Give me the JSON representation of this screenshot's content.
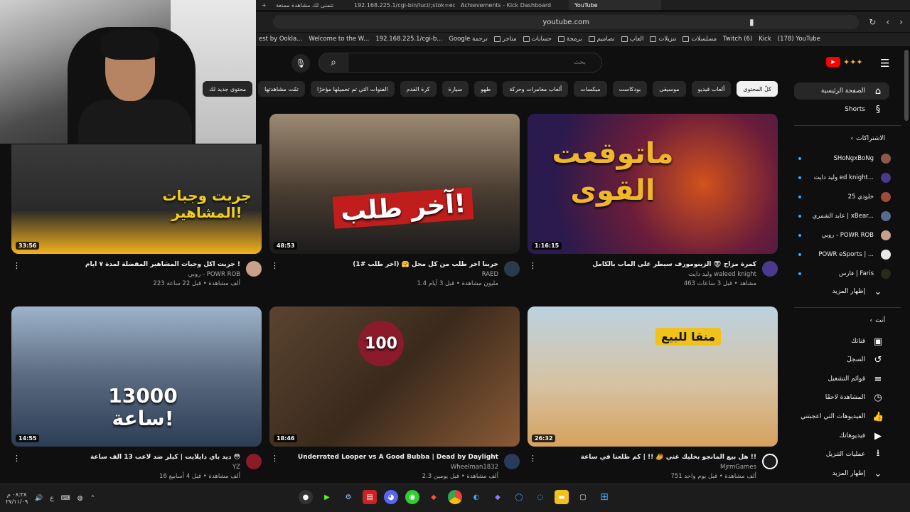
{
  "browser": {
    "tabs": [
      "192.168.225.1/cgi-bin/luci/;stok=ed3",
      "Achievements - Kick Dashboard",
      "YouTube"
    ],
    "tab_left_partial": "تتمنى لك مشاهدة ممتعة",
    "url": "youtube.com",
    "bookmarks": [
      "est by Ookla...",
      "Welcome to the W...",
      "192.168.225.1/cgi-b...",
      "Google ترجمة",
      "متاجر",
      "حسابات",
      "برمجة",
      "تصاميم",
      "العاب",
      "تنزيلات",
      "مسلسلات",
      "Twitch (6)",
      "Kick",
      "(178) YouTube"
    ]
  },
  "masthead": {
    "search_placeholder": "بحث"
  },
  "chips": [
    "كلّ المحتوى",
    "ألعاب فيديو",
    "موسيقى",
    "بودكاست",
    "ميكسات",
    "ألعاب مغامرات وحركة",
    "طهو",
    "سيارة",
    "كرة القدم",
    "الفنوات التي تم تحميلها مؤخرًا",
    "تمّت مشاهدتها",
    "محتوى جديد لك"
  ],
  "sidebar": {
    "home": "الصفحة الرئيسية",
    "shorts": "Shorts",
    "subs_header": "الاشتراكات",
    "subscriptions": [
      "SHoNgxBoNg",
      "وليد دايت ed knight...",
      "خلودي 25",
      "عابد الشمري | xBear...",
      "روبي - POWR ROB",
      "POWR eSports | ...",
      "فارس | Faris"
    ],
    "show_more": "إظهار المزيد",
    "you_header": "أنت",
    "you_items": [
      "قناتك",
      "السجلّ",
      "قوائم التشغيل",
      "المشاهدة لاحقًا",
      "الفيديوهات التي أعجبتني",
      "فيديوهاتك",
      "عمليات التنزيل"
    ],
    "show_more_2": "إظهار المزيد"
  },
  "videos": [
    {
      "title": "كمرة مزاح 👽 الزينومورف سيطر على الماب بالكامل",
      "channel": "وليد دايت waleed knight",
      "stats": "463 مشاهد • قبل 3 ساعات",
      "duration": "1:16:15",
      "thumb_text": "ماتوقعت القوى",
      "colors": [
        "#2a1a4d",
        "#d1521c"
      ]
    },
    {
      "title": "جربنا آخر طلب من كل محل 🤗 (آخر طلب #1)",
      "channel": "RAED",
      "stats": "1.4 مليون مشاهدة • قبل 3 أيام",
      "duration": "48:53",
      "thumb_text": "آخر طلب!",
      "colors": [
        "#7a6a55",
        "#c21d1d"
      ]
    },
    {
      "title": "جربت اكل وجبات المشاهير المفضلة لمدة ٧ ايام !",
      "channel": "روبي - POWR ROB",
      "stats": "223 ألف مشاهدة • قبل 22 ساعة",
      "duration": "33:56",
      "thumb_text": "جربت وجبات المشاهير!",
      "colors": [
        "#2a2a2a",
        "#f2b21c"
      ]
    },
    {
      "title": "هل بيع المانجو بخليك غني 🥭 !! | كم طلعنا في ساعة !!",
      "channel": "MjrmGames",
      "stats": "751 ألف مشاهدة • قبل يوم واحد",
      "duration": "26:32",
      "thumb_text": "منقا للبيع",
      "colors": [
        "#bcd2e0",
        "#d6a15d"
      ]
    },
    {
      "title": "Underrated Looper vs A Good Bubba | Dead by Daylight",
      "channel": "Wheelman1832",
      "stats": "2.3 ألف مشاهدة • قبل يومين",
      "duration": "18:46",
      "thumb_text": "100",
      "colors": [
        "#3a2a1c",
        "#8a5a35"
      ]
    },
    {
      "title": "ديد باي دايلايت | كيلر ضد لاعب 13 ألف ساعة 😳",
      "channel": "YZ",
      "stats": "16 ألف مشاهدة • قبل 4 أسابيع",
      "duration": "14:55",
      "thumb_text": "13000 ساعة!",
      "colors": [
        "#9db3c9",
        "#2c3d55"
      ]
    }
  ],
  "taskbar": {
    "time": "٠٨:٣٨ م",
    "date": "٢٧/١١/٠٩",
    "lang": "ع"
  }
}
